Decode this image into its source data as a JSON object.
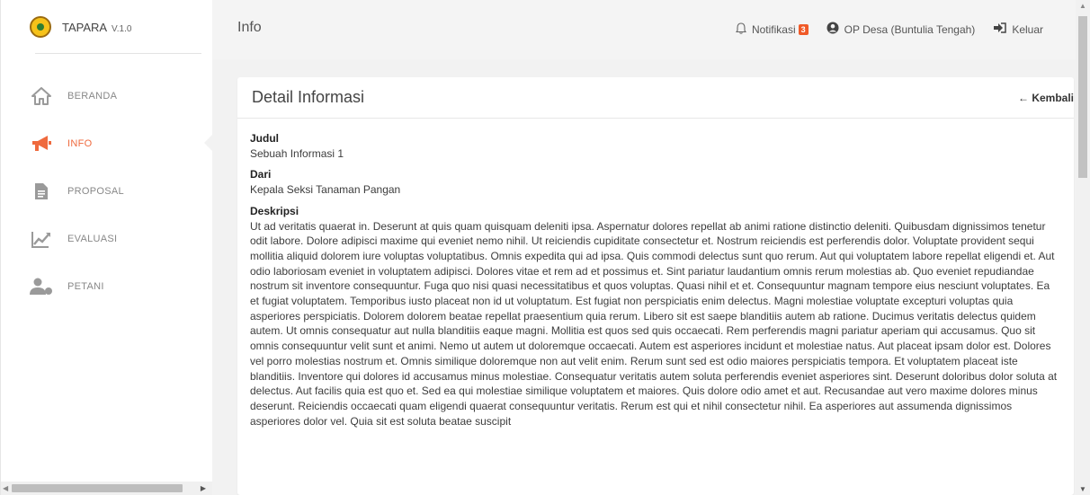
{
  "app": {
    "name": "TAPARA",
    "version": "V.1.0"
  },
  "sidebar": {
    "items": [
      {
        "label": "BERANDA",
        "icon": "home-icon"
      },
      {
        "label": "INFO",
        "icon": "megaphone-icon",
        "active": true
      },
      {
        "label": "PROPOSAL",
        "icon": "document-icon"
      },
      {
        "label": "EVALUASI",
        "icon": "evaluation-chart-icon"
      },
      {
        "label": "PETANI",
        "icon": "farmer-user-icon"
      }
    ]
  },
  "header": {
    "title": "Info",
    "notifications_label": "Notifikasi",
    "notifications_count": "3",
    "user_label": "OP Desa (Buntulia Tengah)",
    "logout_label": "Keluar"
  },
  "card": {
    "title": "Detail Informasi",
    "back_label": "← Kembali",
    "judul_label": "Judul",
    "judul_value": "Sebuah Informasi 1",
    "dari_label": "Dari",
    "dari_value": "Kepala Seksi Tanaman Pangan",
    "deskripsi_label": "Deskripsi",
    "deskripsi_value": "Ut ad veritatis quaerat in. Deserunt at quis quam quisquam deleniti ipsa. Aspernatur dolores repellat ab animi ratione distinctio deleniti. Quibusdam dignissimos tenetur odit labore. Dolore adipisci maxime qui eveniet nemo nihil. Ut reiciendis cupiditate consectetur et. Nostrum reiciendis est perferendis dolor. Voluptate provident sequi mollitia aliquid dolorem iure voluptas voluptatibus. Omnis expedita qui ad ipsa. Quis commodi delectus sunt quo rerum. Aut qui voluptatem labore repellat eligendi et. Aut odio laboriosam eveniet in voluptatem adipisci. Dolores vitae et rem ad et possimus et. Sint pariatur laudantium omnis rerum molestias ab. Quo eveniet repudiandae nostrum sit inventore consequuntur. Fuga quo nisi quasi necessitatibus et quos voluptas. Quasi nihil et et. Consequuntur magnam tempore eius nesciunt voluptates. Ea et fugiat voluptatem. Temporibus iusto placeat non id ut voluptatum. Est fugiat non perspiciatis enim delectus. Magni molestiae voluptate excepturi voluptas quia asperiores perspiciatis. Dolorem dolorem beatae repellat praesentium quia rerum. Libero sit est saepe blanditiis autem ab ratione. Ducimus veritatis delectus quidem autem. Ut omnis consequatur aut nulla blanditiis eaque magni. Mollitia est quos sed quis occaecati. Rem perferendis magni pariatur aperiam qui accusamus. Quo sit omnis consequuntur velit sunt et animi. Nemo ut autem ut doloremque occaecati. Autem est asperiores incidunt et molestiae natus. Aut placeat ipsam dolor est. Dolores vel porro molestias nostrum et. Omnis similique doloremque non aut velit enim. Rerum sunt sed est odio maiores perspiciatis tempora. Et voluptatem placeat iste blanditiis. Inventore qui dolores id accusamus minus molestiae. Consequatur veritatis autem soluta perferendis eveniet asperiores sint. Deserunt doloribus dolor soluta at delectus. Aut facilis quia est quo et. Sed ea qui molestiae similique voluptatem et maiores. Quis dolore odio amet et aut. Recusandae aut vero maxime dolores minus deserunt. Reiciendis occaecati quam eligendi quaerat consequuntur veritatis. Rerum est qui et nihil consectetur nihil. Ea asperiores aut assumenda dignissimos asperiores dolor vel. Quia sit est soluta beatae suscipit"
  },
  "colors": {
    "accent": "#ef6a3e",
    "badge": "#f05a28",
    "background": "#f2f2f2"
  }
}
